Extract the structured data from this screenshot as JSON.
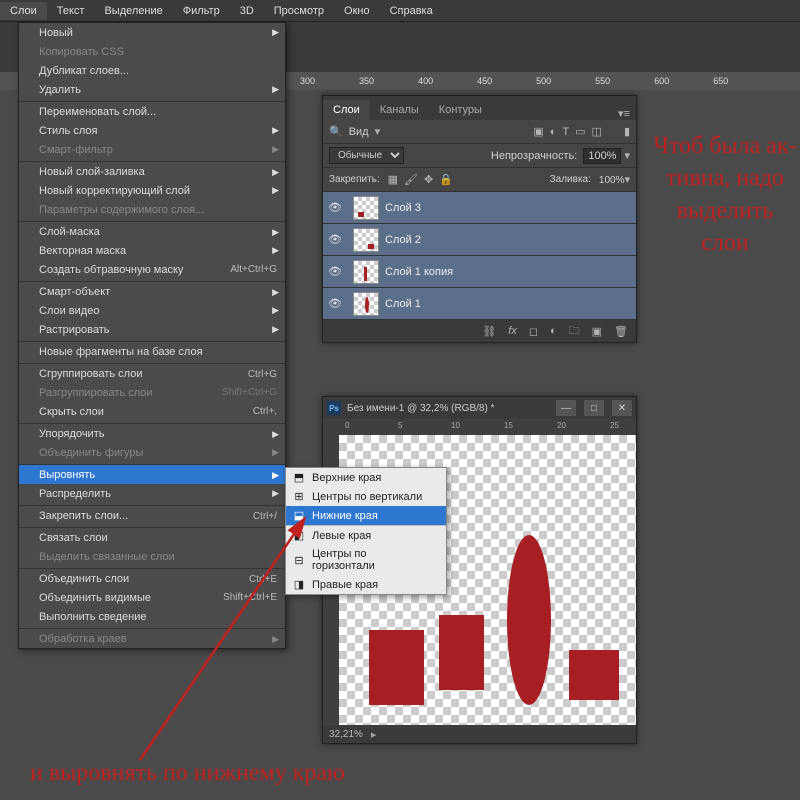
{
  "menubar": [
    "Слои",
    "Текст",
    "Выделение",
    "Фильтр",
    "3D",
    "Просмотр",
    "Окно",
    "Справка"
  ],
  "rulerTicks": [
    "300",
    "350",
    "400",
    "450",
    "500",
    "550",
    "600",
    "650"
  ],
  "dropdown": [
    {
      "label": "Новый",
      "arrow": true
    },
    {
      "label": "Копировать CSS",
      "disabled": true
    },
    {
      "label": "Дубликат слоев..."
    },
    {
      "label": "Удалить",
      "arrow": true
    },
    {
      "label": "Переименовать слой...",
      "sep": true
    },
    {
      "label": "Стиль слоя",
      "arrow": true
    },
    {
      "label": "Смарт-фильтр",
      "arrow": true,
      "disabled": true
    },
    {
      "label": "Новый слой-заливка",
      "arrow": true,
      "sep": true
    },
    {
      "label": "Новый корректирующий слой",
      "arrow": true
    },
    {
      "label": "Параметры содержимого слоя...",
      "disabled": true
    },
    {
      "label": "Слой-маска",
      "arrow": true,
      "sep": true
    },
    {
      "label": "Векторная маска",
      "arrow": true
    },
    {
      "label": "Создать обтравочную маску",
      "sc": "Alt+Ctrl+G"
    },
    {
      "label": "Смарт-объект",
      "arrow": true,
      "sep": true
    },
    {
      "label": "Слои видео",
      "arrow": true
    },
    {
      "label": "Растрировать",
      "arrow": true
    },
    {
      "label": "Новые фрагменты на базе слоя",
      "sep": true
    },
    {
      "label": "Сгруппировать слои",
      "sc": "Ctrl+G",
      "sep": true
    },
    {
      "label": "Разгруппировать слои",
      "sc": "Shift+Ctrl+G",
      "disabled": true
    },
    {
      "label": "Скрыть слои",
      "sc": "Ctrl+,"
    },
    {
      "label": "Упорядочить",
      "arrow": true,
      "sep": true
    },
    {
      "label": "Объединить фигуры",
      "arrow": true,
      "disabled": true
    },
    {
      "label": "Выровнять",
      "arrow": true,
      "sep": true,
      "hl": true
    },
    {
      "label": "Распределить",
      "arrow": true
    },
    {
      "label": "Закрепить слои...",
      "sc": "Ctrl+/",
      "sep": true
    },
    {
      "label": "Связать слои",
      "sep": true
    },
    {
      "label": "Выделить связанные слои",
      "disabled": true
    },
    {
      "label": "Объединить слои",
      "sc": "Ctrl+E",
      "sep": true
    },
    {
      "label": "Объединить видимые",
      "sc": "Shift+Ctrl+E"
    },
    {
      "label": "Выполнить сведение"
    },
    {
      "label": "Обработка краев",
      "arrow": true,
      "disabled": true,
      "sep": true
    }
  ],
  "submenu": [
    {
      "label": "Верхние края",
      "icon": "⬒"
    },
    {
      "label": "Центры по вертикали",
      "icon": "⊞"
    },
    {
      "label": "Нижние края",
      "icon": "⬓",
      "hl": true
    },
    {
      "label": "Левые края",
      "icon": "◧",
      "sep": true
    },
    {
      "label": "Центры по горизонтали",
      "icon": "⊟"
    },
    {
      "label": "Правые края",
      "icon": "◨"
    }
  ],
  "layersPanel": {
    "tabs": [
      "Слои",
      "Каналы",
      "Контуры"
    ],
    "filterLabel": "Вид",
    "blendMode": "Обычные",
    "opacityLabel": "Непрозрачность:",
    "opacityValue": "100%",
    "fillLabel": "Заливка:",
    "fillValue": "100%",
    "lockLabel": "Закрепить:",
    "layers": [
      {
        "name": "Слой 3"
      },
      {
        "name": "Слой 2"
      },
      {
        "name": "Слой 1 копия"
      },
      {
        "name": "Слой 1"
      }
    ]
  },
  "docwin": {
    "title": "Без имени-1 @ 32,2% (RGB/8) *",
    "hruler": [
      "0",
      "5",
      "10",
      "15",
      "20",
      "25"
    ],
    "zoom": "32,21%"
  },
  "annoRight": "Чтоб была ак­тивна, надо вы­делить слои",
  "annoBottom": "и выровнять по нижнему краю"
}
